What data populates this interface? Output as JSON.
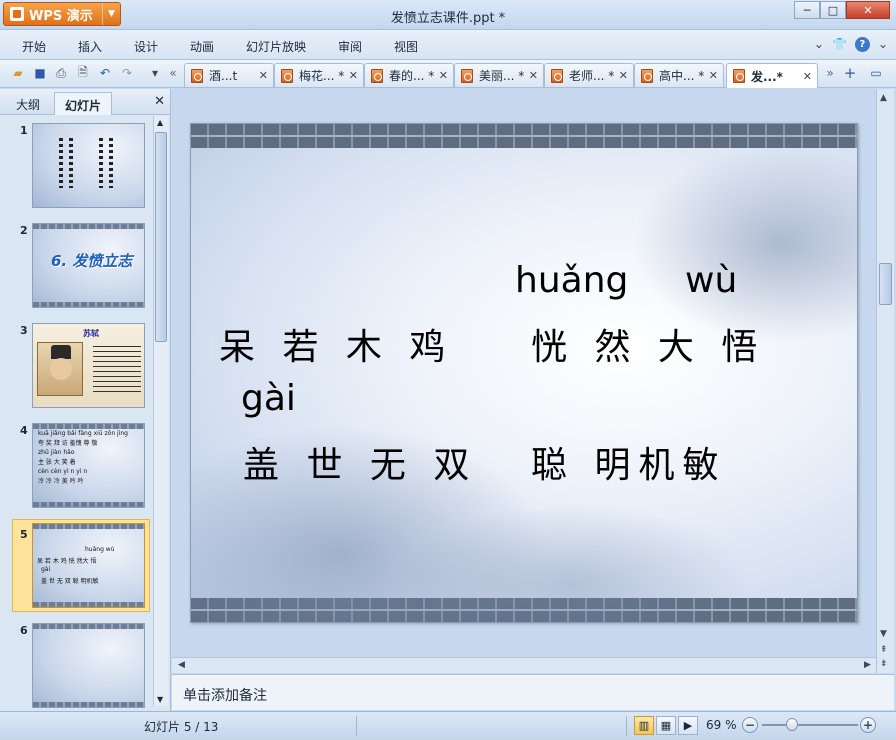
{
  "app": {
    "button_label": "WPS 演示",
    "window_title": "发愤立志课件.ppt *",
    "win_buttons": {
      "minimize": "─",
      "maximize": "□",
      "close": "✕"
    }
  },
  "menu": {
    "items": [
      "开始",
      "插入",
      "设计",
      "动画",
      "幻灯片放映",
      "审阅",
      "视图"
    ]
  },
  "tabs": [
    {
      "label": "酒...t",
      "active": false
    },
    {
      "label": "梅花... *",
      "active": false
    },
    {
      "label": "春的... *",
      "active": false
    },
    {
      "label": "美丽... *",
      "active": false
    },
    {
      "label": "老师... *",
      "active": false
    },
    {
      "label": "高中... *",
      "active": false
    },
    {
      "label": "发...*",
      "active": true
    }
  ],
  "left_pane": {
    "tab_outline": "大纲",
    "tab_slides": "幻灯片",
    "close": "✕",
    "thumbnails": [
      {
        "num": "1"
      },
      {
        "num": "2",
        "title": "6. 发愤立志"
      },
      {
        "num": "3",
        "title": "苏轼"
      },
      {
        "num": "4"
      },
      {
        "num": "5",
        "lines": [
          "huǎng   wù",
          "呆 若 木 鸡    恍 然大 悟",
          "gài",
          "盖  世  无 双    聪 明机敏"
        ]
      },
      {
        "num": "6"
      }
    ],
    "thumb4_lines": [
      "kuā jiǎng   bǎi fāng     xiū    zǒn jìng",
      "夸 奖     拜 访      羞愧   尊 敬",
      "zhǔ jiàn          hǎo",
      "主 张             大 笑 着",
      "cèn cèn          yì n yì n",
      "冷 冷 冷         美 吟 吟"
    ]
  },
  "slide": {
    "pinyin_1": "huǎng",
    "pinyin_2": "wù",
    "line_1_left": "呆 若 木 鸡",
    "line_1_right": "恍 然 大 悟",
    "pinyin_3": "gài",
    "line_2_left": "盖 世 无 双",
    "line_2_right": "聪 明机敏"
  },
  "notes_placeholder": "单击添加备注",
  "status": {
    "slide_count": "幻灯片 5 / 13",
    "zoom": "69 %"
  }
}
